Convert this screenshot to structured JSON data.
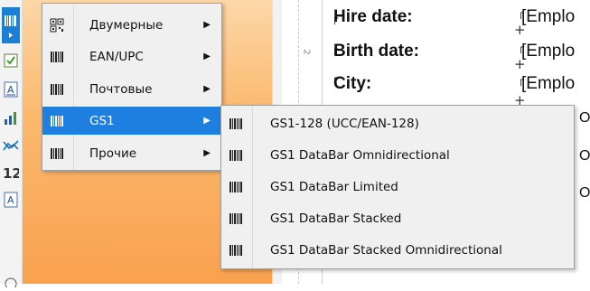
{
  "toolbar": {
    "icons": [
      "barcode-icon",
      "checkbox-icon",
      "text-box-icon",
      "bar-chart-icon",
      "sparkline-icon",
      "number-icon",
      "text-icon",
      "gauge-icon"
    ],
    "active_index": 0
  },
  "report": {
    "fields": [
      {
        "label": "Hire date:",
        "value": "[Emplo"
      },
      {
        "label": "Birth date:",
        "value": "[Emplo"
      },
      {
        "label": "City:",
        "value": "[Emplo"
      }
    ],
    "ruler_mark": "2",
    "fragments": [
      "O",
      "O",
      "O"
    ]
  },
  "menu": {
    "categories": [
      {
        "label": "Двумерные",
        "icon": "qr-code-icon",
        "has_submenu": true,
        "selected": false
      },
      {
        "label": "EAN/UPC",
        "icon": "barcode-icon",
        "has_submenu": true,
        "selected": false
      },
      {
        "label": "Почтовые",
        "icon": "barcode-icon",
        "has_submenu": true,
        "selected": false
      },
      {
        "label": "GS1",
        "icon": "barcode-icon",
        "has_submenu": true,
        "selected": true
      },
      {
        "label": "Прочие",
        "icon": "barcode-icon",
        "has_submenu": true,
        "selected": false
      }
    ],
    "submenu": [
      {
        "label": "GS1-128 (UCC/EAN-128)",
        "icon": "barcode-icon"
      },
      {
        "label": "GS1 DataBar Omnidirectional",
        "icon": "barcode-icon"
      },
      {
        "label": "GS1 DataBar Limited",
        "icon": "barcode-icon"
      },
      {
        "label": "GS1 DataBar Stacked",
        "icon": "barcode-icon"
      },
      {
        "label": "GS1 DataBar Stacked Omnidirectional",
        "icon": "barcode-icon"
      }
    ]
  },
  "colors": {
    "selection": "#1f7fe0",
    "band_orange": "#f9a14e",
    "menu_bg": "#f0f0f0"
  }
}
